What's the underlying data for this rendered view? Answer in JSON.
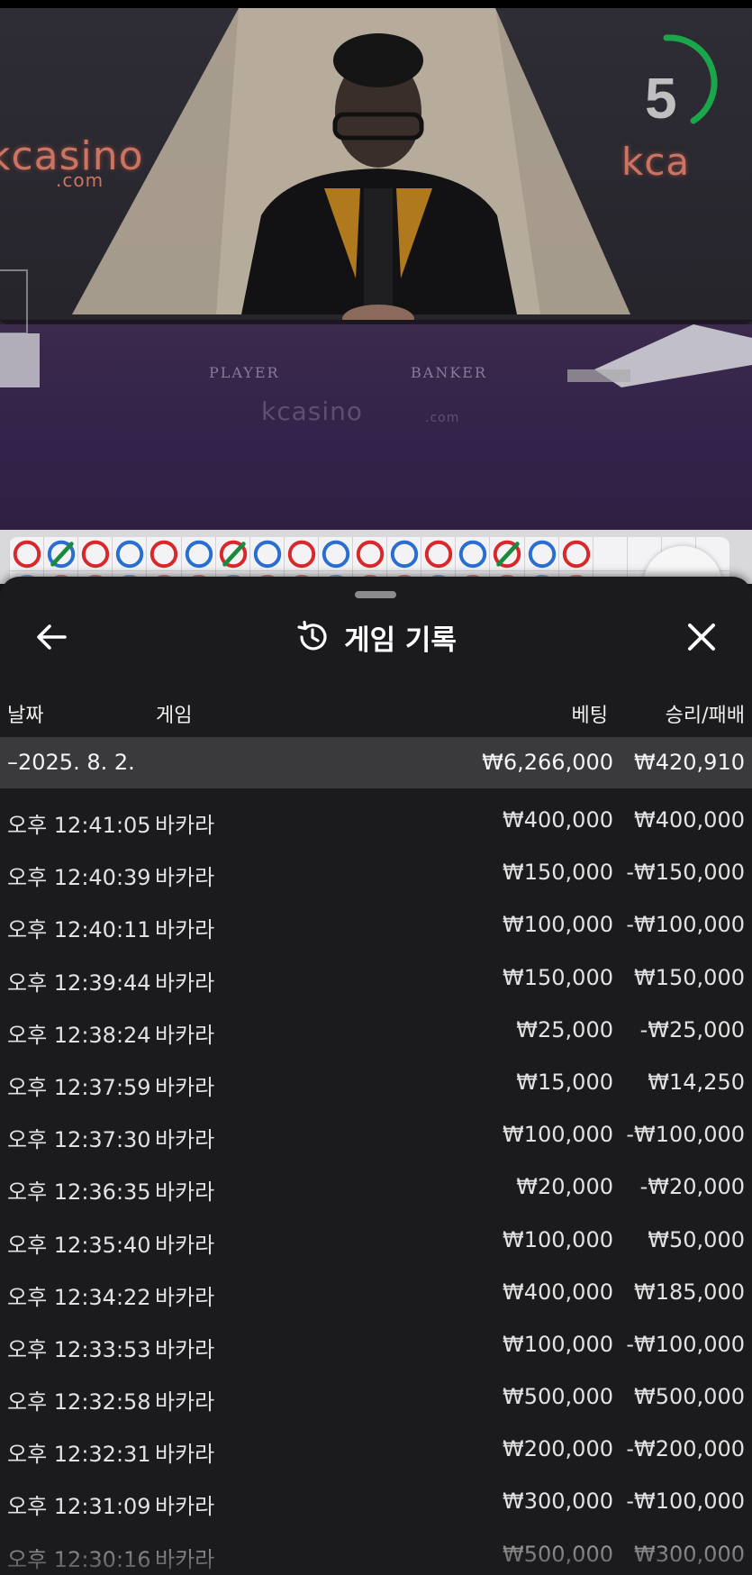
{
  "video": {
    "timer_value": "5",
    "logo_left": "kcasino",
    "logo_left_sub": ".com",
    "logo_right": "kca",
    "logo_table": "kcasino",
    "logo_table_sub": ".com",
    "label_player": "PLAYER",
    "label_banker": "BANKER",
    "timer_color": "#1aa64a"
  },
  "road": {
    "results": [
      "red",
      "blue-tie",
      "red",
      "blue",
      "red",
      "blue",
      "red-tie",
      "blue",
      "red",
      "blue",
      "red",
      "blue",
      "red",
      "blue",
      "red-tie",
      "blue",
      "red"
    ],
    "colors": {
      "red": "#d8282c",
      "blue": "#2a6fd0",
      "tie": "#1a8a3c"
    }
  },
  "panel": {
    "title": "게임 기록",
    "columns": {
      "date": "날짜",
      "game": "게임",
      "bet": "베팅",
      "win": "승리/패배"
    },
    "summary": {
      "date": "–2025. 8. 2.",
      "bet": "₩6,266,000",
      "win": "₩420,910"
    },
    "rows": [
      {
        "time": "오후 12:41:05",
        "game": "바카라",
        "bet": "₩400,000",
        "win": "₩400,000"
      },
      {
        "time": "오후 12:40:39",
        "game": "바카라",
        "bet": "₩150,000",
        "win": "-₩150,000"
      },
      {
        "time": "오후 12:40:11",
        "game": "바카라",
        "bet": "₩100,000",
        "win": "-₩100,000"
      },
      {
        "time": "오후 12:39:44",
        "game": "바카라",
        "bet": "₩150,000",
        "win": "₩150,000"
      },
      {
        "time": "오후 12:38:24",
        "game": "바카라",
        "bet": "₩25,000",
        "win": "-₩25,000"
      },
      {
        "time": "오후 12:37:59",
        "game": "바카라",
        "bet": "₩15,000",
        "win": "₩14,250"
      },
      {
        "time": "오후 12:37:30",
        "game": "바카라",
        "bet": "₩100,000",
        "win": "-₩100,000"
      },
      {
        "time": "오후 12:36:35",
        "game": "바카라",
        "bet": "₩20,000",
        "win": "-₩20,000"
      },
      {
        "time": "오후 12:35:40",
        "game": "바카라",
        "bet": "₩100,000",
        "win": "₩50,000"
      },
      {
        "time": "오후 12:34:22",
        "game": "바카라",
        "bet": "₩400,000",
        "win": "₩185,000"
      },
      {
        "time": "오후 12:33:53",
        "game": "바카라",
        "bet": "₩100,000",
        "win": "-₩100,000"
      },
      {
        "time": "오후 12:32:58",
        "game": "바카라",
        "bet": "₩500,000",
        "win": "₩500,000"
      },
      {
        "time": "오후 12:32:31",
        "game": "바카라",
        "bet": "₩200,000",
        "win": "-₩200,000"
      },
      {
        "time": "오후 12:31:09",
        "game": "바카라",
        "bet": "₩300,000",
        "win": "-₩100,000"
      },
      {
        "time": "오후 12:30:16",
        "game": "바카라",
        "bet": "₩500,000",
        "win": "₩300,000"
      }
    ]
  }
}
